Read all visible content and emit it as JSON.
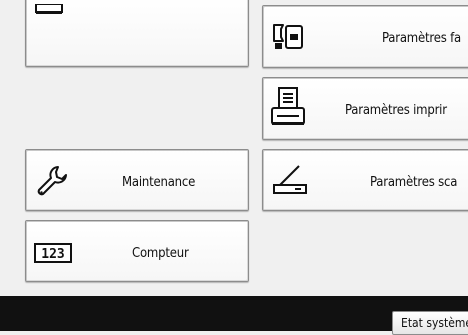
{
  "menu": {
    "left": [
      {
        "id": "top-left",
        "label": "",
        "icon": "device-icon"
      },
      {
        "id": "maintenance",
        "label": "Maintenance",
        "icon": "wrench-icon"
      },
      {
        "id": "counter",
        "label": "Compteur",
        "icon": "counter-123-icon",
        "icon_text": "123"
      }
    ],
    "right": [
      {
        "id": "fax",
        "label": "Paramètres fa",
        "icon": "fax-settings-icon"
      },
      {
        "id": "printer",
        "label": "Paramètres imprir",
        "icon": "printer-settings-icon"
      },
      {
        "id": "scanner",
        "label": "Paramètres sca",
        "icon": "scanner-settings-icon"
      }
    ]
  },
  "footer": {
    "status_label": "Etat système"
  }
}
